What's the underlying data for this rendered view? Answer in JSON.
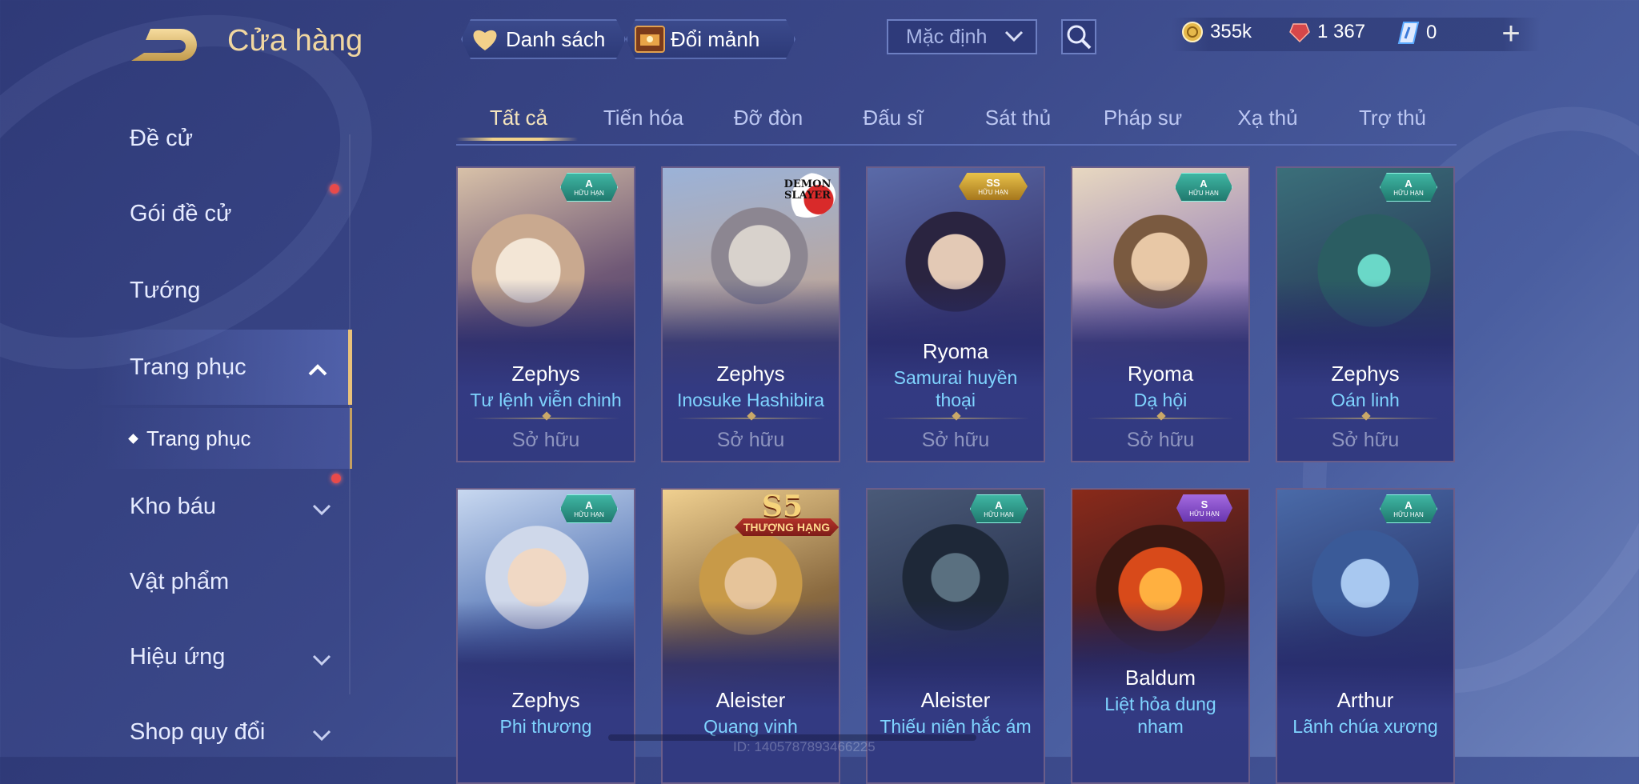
{
  "header": {
    "title": "Cửa hàng",
    "list_label": "Danh sách",
    "exchange_label": "Đổi mảnh",
    "sort_value": "Mặc định"
  },
  "currency": {
    "gold": "355k",
    "ruby": "1 367",
    "voucher": "0"
  },
  "sidebar": {
    "items": [
      {
        "label": "Đề cử"
      },
      {
        "label": "Gói đề cử"
      },
      {
        "label": "Tướng"
      },
      {
        "label": "Trang phục"
      },
      {
        "label": "Kho báu"
      },
      {
        "label": "Vật phẩm"
      },
      {
        "label": "Hiệu ứng"
      },
      {
        "label": "Shop quy đổi"
      }
    ],
    "sub_item": "Trang phục"
  },
  "tabs": [
    "Tất cả",
    "Tiến hóa",
    "Đỡ đòn",
    "Đấu sĩ",
    "Sát thủ",
    "Pháp sư",
    "Xạ thủ",
    "Trợ thủ"
  ],
  "badge_sub": "HỮU HẠN",
  "cards": [
    {
      "hero": "Zephys",
      "skin": "Tư lệnh viễn chinh",
      "status": "Sở hữu",
      "grade": "A"
    },
    {
      "hero": "Zephys",
      "skin": "Inosuke Hashibira",
      "status": "Sở hữu",
      "grade": "",
      "collab": "DEMON SLAYER"
    },
    {
      "hero": "Ryoma",
      "skin": "Samurai huyền",
      "skin2": "thoại",
      "status": "Sở hữu",
      "grade": "SS"
    },
    {
      "hero": "Ryoma",
      "skin": "Dạ hội",
      "status": "Sở hữu",
      "grade": "A"
    },
    {
      "hero": "Zephys",
      "skin": "Oán linh",
      "status": "Sở hữu",
      "grade": "A"
    },
    {
      "hero": "Zephys",
      "skin": "Phi thương",
      "grade": "A"
    },
    {
      "hero": "Aleister",
      "skin": "Quang vinh",
      "grade": "",
      "rank_big": "S5",
      "rank_label": "THƯỢNG HẠNG"
    },
    {
      "hero": "Aleister",
      "skin": "Thiếu niên hắc ám",
      "grade": "A"
    },
    {
      "hero": "Baldum",
      "skin": "Liệt hỏa dung",
      "skin2": "nham",
      "grade": "S"
    },
    {
      "hero": "Arthur",
      "skin": "Lãnh chúa xương",
      "grade": "A"
    }
  ],
  "watermark": "ID: 1405787893466225",
  "colors": {
    "accent_gold": "#f1d28a",
    "skin_name": "#7fd4ff",
    "notification": "#e84a4a"
  }
}
